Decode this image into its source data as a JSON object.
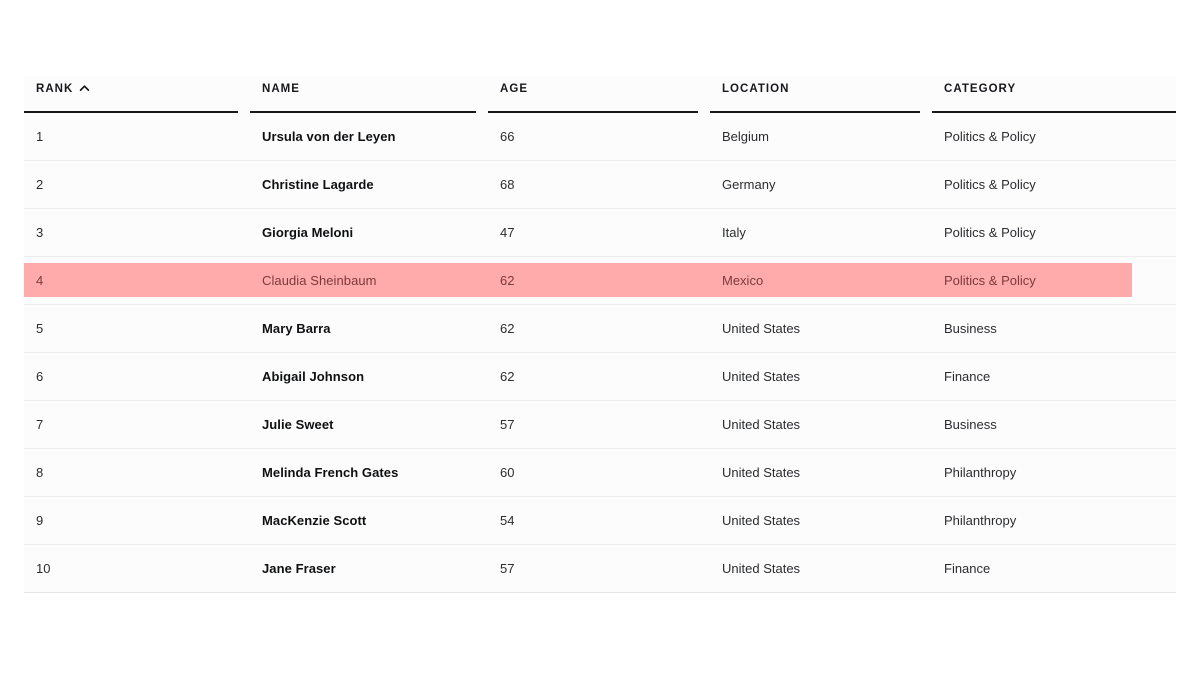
{
  "table": {
    "name": "leaderboard-table",
    "sort": {
      "column": "RANK",
      "direction": "ascending",
      "icon": "chevron-up-icon"
    },
    "columns": [
      {
        "key": "rank",
        "label": "RANK"
      },
      {
        "key": "name",
        "label": "NAME"
      },
      {
        "key": "age",
        "label": "AGE"
      },
      {
        "key": "location",
        "label": "LOCATION"
      },
      {
        "key": "category",
        "label": "CATEGORY"
      }
    ],
    "highlight_color": "#ffabab",
    "highlighted_rank": "4",
    "rows": [
      {
        "rank": "1",
        "name": "Ursula von der Leyen",
        "age": "66",
        "location": "Belgium",
        "category": "Politics & Policy",
        "highlighted": false
      },
      {
        "rank": "2",
        "name": "Christine Lagarde",
        "age": "68",
        "location": "Germany",
        "category": "Politics & Policy",
        "highlighted": false
      },
      {
        "rank": "3",
        "name": "Giorgia Meloni",
        "age": "47",
        "location": "Italy",
        "category": "Politics & Policy",
        "highlighted": false
      },
      {
        "rank": "4",
        "name": "Claudia Sheinbaum",
        "age": "62",
        "location": "Mexico",
        "category": "Politics & Policy",
        "highlighted": true
      },
      {
        "rank": "5",
        "name": "Mary Barra",
        "age": "62",
        "location": "United States",
        "category": "Business",
        "highlighted": false
      },
      {
        "rank": "6",
        "name": "Abigail Johnson",
        "age": "62",
        "location": "United States",
        "category": "Finance",
        "highlighted": false
      },
      {
        "rank": "7",
        "name": "Julie Sweet",
        "age": "57",
        "location": "United States",
        "category": "Business",
        "highlighted": false
      },
      {
        "rank": "8",
        "name": "Melinda French Gates",
        "age": "60",
        "location": "United States",
        "category": "Philanthropy",
        "highlighted": false
      },
      {
        "rank": "9",
        "name": "MacKenzie Scott",
        "age": "54",
        "location": "United States",
        "category": "Philanthropy",
        "highlighted": false
      },
      {
        "rank": "10",
        "name": "Jane Fraser",
        "age": "57",
        "location": "United States",
        "category": "Finance",
        "highlighted": false
      }
    ]
  }
}
